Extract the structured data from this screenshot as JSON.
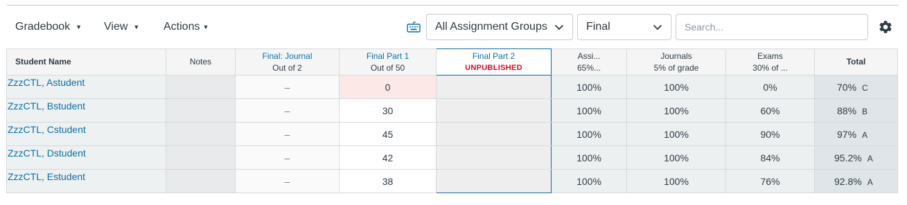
{
  "toolbar": {
    "gradebook_label": "Gradebook",
    "view_label": "View",
    "actions_label": "Actions",
    "caret": "▼",
    "assignment_groups_selected": "All Assignment Groups",
    "grading_period_selected": "Final",
    "search_placeholder": "Search...",
    "icons": [
      "keyboard-icon",
      "chevron-down-icon",
      "gear-icon"
    ]
  },
  "columns": {
    "student_name": "Student Name",
    "notes": "Notes",
    "journal": {
      "title": "Final: Journal",
      "sub": "Out of 2"
    },
    "part1": {
      "title": "Final Part 1",
      "sub": "Out of 50"
    },
    "part2": {
      "title": "Final Part 2",
      "sub": "UNPUBLISHED"
    },
    "assignments": {
      "title": "Assi...",
      "sub": "65%..."
    },
    "journals": {
      "title": "Journals",
      "sub": "5% of grade"
    },
    "exams": {
      "title": "Exams",
      "sub": "30% of ..."
    },
    "total": "Total"
  },
  "rows": [
    {
      "name": "ZzzCTL, Astudent",
      "journal": "–",
      "part1": "0",
      "part2": "",
      "assignments": "100%",
      "journals": "100%",
      "exams": "0%",
      "total": "70%",
      "grade": "C"
    },
    {
      "name": "ZzzCTL, Bstudent",
      "journal": "–",
      "part1": "30",
      "part2": "",
      "assignments": "100%",
      "journals": "100%",
      "exams": "60%",
      "total": "88%",
      "grade": "B"
    },
    {
      "name": "ZzzCTL, Cstudent",
      "journal": "–",
      "part1": "45",
      "part2": "",
      "assignments": "100%",
      "journals": "100%",
      "exams": "90%",
      "total": "97%",
      "grade": "A"
    },
    {
      "name": "ZzzCTL, Dstudent",
      "journal": "–",
      "part1": "42",
      "part2": "",
      "assignments": "100%",
      "journals": "100%",
      "exams": "84%",
      "total": "95.2%",
      "grade": "A"
    },
    {
      "name": "ZzzCTL, Estudent",
      "journal": "–",
      "part1": "38",
      "part2": "",
      "assignments": "100%",
      "journals": "100%",
      "exams": "76%",
      "total": "92.8%",
      "grade": "A"
    }
  ],
  "colors": {
    "link": "#0770a3",
    "unpublished": "#e0061f",
    "low_score_bg": "#fde8e8",
    "active_column_border": "#0770a3"
  }
}
